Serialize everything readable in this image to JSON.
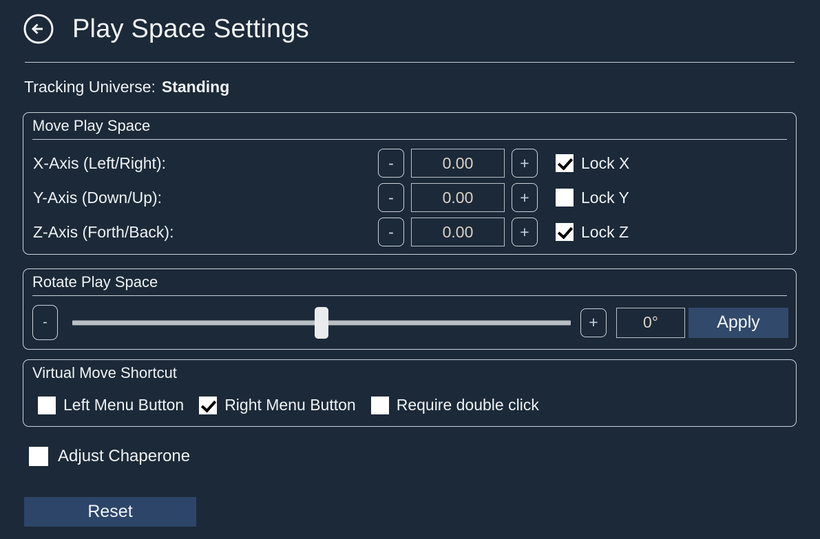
{
  "header": {
    "back_icon": "back-arrow-circle-icon",
    "title": "Play Space Settings"
  },
  "tracking": {
    "label": "Tracking Universe:",
    "value": "Standing"
  },
  "move_group": {
    "title": "Move Play Space",
    "minus_label": "-",
    "plus_label": "+",
    "rows": [
      {
        "label": "X-Axis (Left/Right):",
        "value": "0.00",
        "lock_label": "Lock X",
        "locked": true
      },
      {
        "label": "Y-Axis (Down/Up):",
        "value": "0.00",
        "lock_label": "Lock Y",
        "locked": false
      },
      {
        "label": "Z-Axis (Forth/Back):",
        "value": "0.00",
        "lock_label": "Lock Z",
        "locked": true
      }
    ]
  },
  "rotate_group": {
    "title": "Rotate Play Space",
    "minus_label": "-",
    "plus_label": "+",
    "slider_percent": 50,
    "degrees": "0°",
    "apply_label": "Apply"
  },
  "shortcut_group": {
    "title": "Virtual Move Shortcut",
    "options": [
      {
        "label": "Left Menu Button",
        "checked": false
      },
      {
        "label": "Right Menu Button",
        "checked": true
      },
      {
        "label": "Require double click",
        "checked": false
      }
    ]
  },
  "chaperone": {
    "label": "Adjust Chaperone",
    "checked": false
  },
  "reset": {
    "label": "Reset"
  },
  "colors": {
    "background": "#1c2938",
    "border": "#ccd4dc",
    "text": "#eef2f6",
    "accent_button": "#31496b",
    "value_text": "#d9d2c8",
    "slider_track": "#b8bfc5",
    "slider_handle": "#e9ebed"
  }
}
